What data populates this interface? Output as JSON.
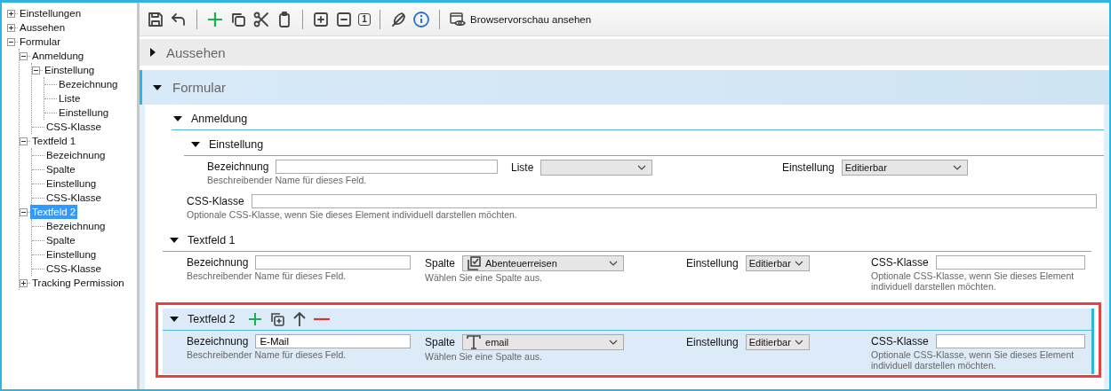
{
  "tree": [
    {
      "label": "Einstellungen",
      "expanded": false,
      "selected": false
    },
    {
      "label": "Aussehen",
      "expanded": false,
      "selected": false
    },
    {
      "label": "Formular",
      "expanded": true,
      "selected": false,
      "children": [
        {
          "label": "Anmeldung",
          "expanded": true,
          "selected": false,
          "children": [
            {
              "label": "Einstellung",
              "expanded": true,
              "selected": false,
              "children": [
                {
                  "label": "Bezeichnung",
                  "selected": false
                },
                {
                  "label": "Liste",
                  "selected": false
                },
                {
                  "label": "Einstellung",
                  "selected": false
                }
              ]
            },
            {
              "label": "CSS-Klasse",
              "selected": false
            }
          ]
        },
        {
          "label": "Textfeld 1",
          "expanded": true,
          "selected": false,
          "children": [
            {
              "label": "Bezeichnung",
              "selected": false
            },
            {
              "label": "Spalte",
              "selected": false
            },
            {
              "label": "Einstellung",
              "selected": false
            },
            {
              "label": "CSS-Klasse",
              "selected": false
            }
          ]
        },
        {
          "label": "Textfeld 2",
          "expanded": true,
          "selected": true,
          "children": [
            {
              "label": "Bezeichnung",
              "selected": false
            },
            {
              "label": "Spalte",
              "selected": false
            },
            {
              "label": "Einstellung",
              "selected": false
            },
            {
              "label": "CSS-Klasse",
              "selected": false
            }
          ]
        },
        {
          "label": "Tracking Permission",
          "expanded": false,
          "selected": false
        }
      ]
    }
  ],
  "toolbar": {
    "level_button": "1",
    "preview_label": "Browservorschau ansehen"
  },
  "panels": [
    {
      "title": "Aussehen",
      "expanded": false
    },
    {
      "title": "Formular",
      "expanded": true
    }
  ],
  "anmeldung": {
    "title": "Anmeldung",
    "expanded": true,
    "einstellung": {
      "title": "Einstellung",
      "expanded": true,
      "bezeichnung": {
        "label": "Bezeichnung",
        "hint": "Beschreibender Name für dieses Feld."
      },
      "liste": {
        "label": "Liste"
      },
      "einstellung": {
        "label": "Einstellung",
        "value": "Editierbar"
      }
    },
    "css": {
      "label": "CSS-Klasse",
      "hint": "Optionale CSS-Klasse, wenn Sie dieses Element individuell darstellen möchten."
    }
  },
  "textfields": [
    {
      "title": "Textfeld 1",
      "expanded": true,
      "selected": false,
      "annotated": false,
      "bezeichnung": {
        "label": "Bezeichnung",
        "hint": "Beschreibender Name für dieses Feld."
      },
      "spalte": {
        "label": "Spalte",
        "kind": "checkbox",
        "value": "Abenteuerreisen",
        "hint": "Wählen Sie eine Spalte aus."
      },
      "einstellung": {
        "label": "Einstellung",
        "value": "Editierbar"
      },
      "css": {
        "label": "CSS-Klasse",
        "hint": "Optionale CSS-Klasse, wenn Sie dieses Element individuell darstellen möchten."
      }
    },
    {
      "title": "Textfeld 2",
      "expanded": true,
      "selected": true,
      "annotated": true,
      "bezeichnung": {
        "label": "Bezeichnung",
        "value": "E-Mail",
        "hint": "Beschreibender Name für dieses Feld."
      },
      "spalte": {
        "label": "Spalte",
        "kind": "text",
        "value": "email",
        "hint": "Wählen Sie eine Spalte aus."
      },
      "einstellung": {
        "label": "Einstellung",
        "value": "Editierbar"
      },
      "css": {
        "label": "CSS-Klasse",
        "hint": "Optionale CSS-Klasse, wenn Sie dieses Element individuell darstellen möchten."
      }
    }
  ]
}
